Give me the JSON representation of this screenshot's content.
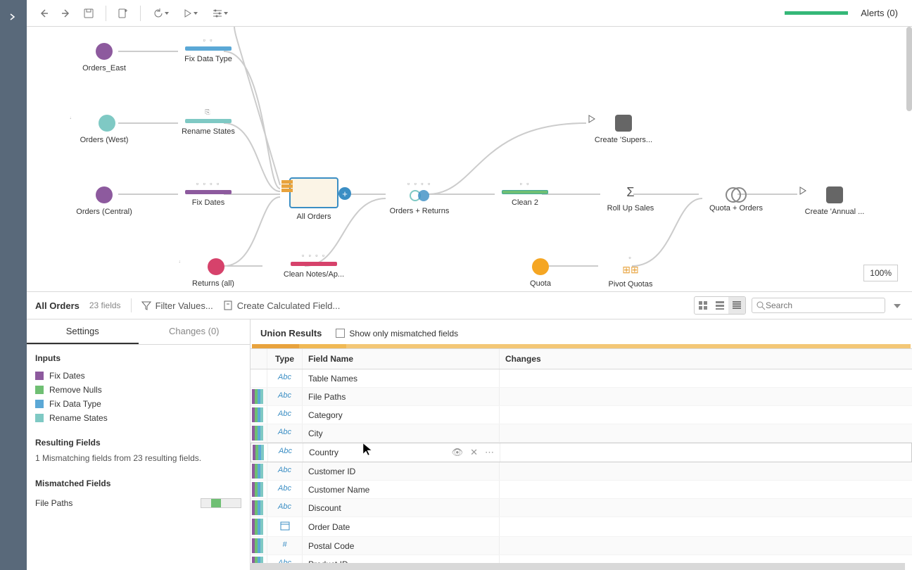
{
  "toolbar": {
    "alerts": "Alerts (0)"
  },
  "canvas": {
    "zoom": "100%",
    "nodes": {
      "orders_east": "Orders_East",
      "fix_data_type": "Fix Data Type",
      "orders_west": "Orders (West)",
      "rename_states": "Rename States",
      "orders_central": "Orders (Central)",
      "fix_dates": "Fix Dates",
      "returns_all": "Returns (all)",
      "clean_notes": "Clean Notes/Ap...",
      "all_orders": "All Orders",
      "orders_returns": "Orders + Returns",
      "clean_2": "Clean 2",
      "roll_up_sales": "Roll Up Sales",
      "quota_orders": "Quota + Orders",
      "create_annual": "Create 'Annual ...",
      "create_supers": "Create 'Supers...",
      "quota": "Quota",
      "pivot_quotas": "Pivot Quotas"
    }
  },
  "lower": {
    "title": "All Orders",
    "fields_count": "23 fields",
    "filter": "Filter Values...",
    "calc": "Create Calculated Field...",
    "search_ph": "Search"
  },
  "tabs": {
    "settings": "Settings",
    "changes": "Changes (0)"
  },
  "inputs": {
    "heading": "Inputs",
    "items": [
      {
        "color": "purple",
        "label": "Fix Dates"
      },
      {
        "color": "green",
        "label": "Remove Nulls"
      },
      {
        "color": "blue",
        "label": "Fix Data Type"
      },
      {
        "color": "teal",
        "label": "Rename States"
      }
    ]
  },
  "resulting": {
    "heading": "Resulting Fields",
    "desc": "1 Mismatching fields from 23 resulting fields."
  },
  "mismatched": {
    "heading": "Mismatched Fields",
    "item": "File Paths"
  },
  "union": {
    "title": "Union Results",
    "show_mismatch": "Show only mismatched fields",
    "headers": {
      "type": "Type",
      "field": "Field Name",
      "changes": "Changes"
    },
    "rows": [
      {
        "stripes": [],
        "type": "Abc",
        "name": "Table Names"
      },
      {
        "stripes": [
          "purple",
          "green",
          "blue",
          "teal"
        ],
        "type": "Abc",
        "name": "File Paths"
      },
      {
        "stripes": [
          "purple",
          "green",
          "blue",
          "teal"
        ],
        "type": "Abc",
        "name": "Category"
      },
      {
        "stripes": [
          "purple",
          "green",
          "blue",
          "teal"
        ],
        "type": "Abc",
        "name": "City"
      },
      {
        "stripes": [
          "purple",
          "green",
          "blue",
          "teal"
        ],
        "type": "Abc",
        "name": "Country",
        "hover": true
      },
      {
        "stripes": [
          "purple",
          "green",
          "blue",
          "teal"
        ],
        "type": "Abc",
        "name": "Customer ID"
      },
      {
        "stripes": [
          "purple",
          "green",
          "blue",
          "teal"
        ],
        "type": "Abc",
        "name": "Customer Name"
      },
      {
        "stripes": [
          "purple",
          "green",
          "blue",
          "teal"
        ],
        "type": "Abc",
        "name": "Discount"
      },
      {
        "stripes": [
          "purple",
          "green",
          "blue",
          "teal"
        ],
        "type": "date",
        "name": "Order Date"
      },
      {
        "stripes": [
          "purple",
          "green",
          "blue",
          "teal"
        ],
        "type": "#",
        "name": "Postal Code"
      },
      {
        "stripes": [
          "purple",
          "green",
          "blue",
          "teal"
        ],
        "type": "Abc",
        "name": "Product ID"
      }
    ]
  }
}
